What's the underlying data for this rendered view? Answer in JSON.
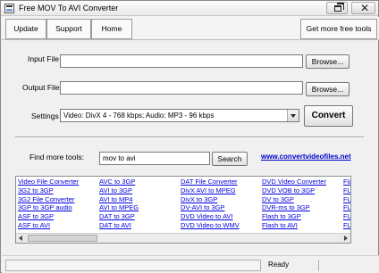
{
  "window": {
    "title": "Free MOV To AVI Converter",
    "icon": "app-icon",
    "title_buttons": [
      "restore-icon",
      "close-icon"
    ]
  },
  "menu": {
    "update": "Update",
    "support": "Support",
    "home": "Home",
    "more_tools": "Get more free tools"
  },
  "form": {
    "input_file_label": "Input File",
    "input_file_value": "",
    "browse_input_label": "Browse...",
    "output_file_label": "Output File",
    "output_file_value": "",
    "browse_output_label": "Browse...",
    "settings_label": "Settings",
    "settings_value": "Video: DivX 4 - 768 kbps; Audio: MP3 - 96 kbps",
    "convert_label": "Convert"
  },
  "find_tools": {
    "label": "Find more tools:",
    "query": "mov to avi",
    "search_label": "Search",
    "website": "www.convertvideofiles.net"
  },
  "links": [
    [
      "Video File Converter",
      "3G2 to 3GP",
      "3G2 File Converter",
      "3GP to 3GP audio",
      "ASF to 3GP",
      "ASF to AVI"
    ],
    [
      "AVC to 3GP",
      "AVI to 3GP",
      "AVI to MP4",
      "AVI to MPEG",
      "DAT to 3GP",
      "DAT to AVI"
    ],
    [
      "DAT File Converter",
      "DivX AVI to MPEG",
      "DivX to 3GP",
      "DV-AVI to 3GP",
      "DVD Video to AVI",
      "DVD Video to WMV"
    ],
    [
      "DVD Video Converter",
      "DVD VOB to 3GP",
      "DV to 3GP",
      "DVR-ms to 3GP",
      "Flash to 3GP",
      "Flash to AVI"
    ],
    [
      "Flash",
      "FLV",
      "FLV",
      "FLV",
      "FLV",
      "FLV"
    ]
  ],
  "status": {
    "text": "Ready"
  }
}
